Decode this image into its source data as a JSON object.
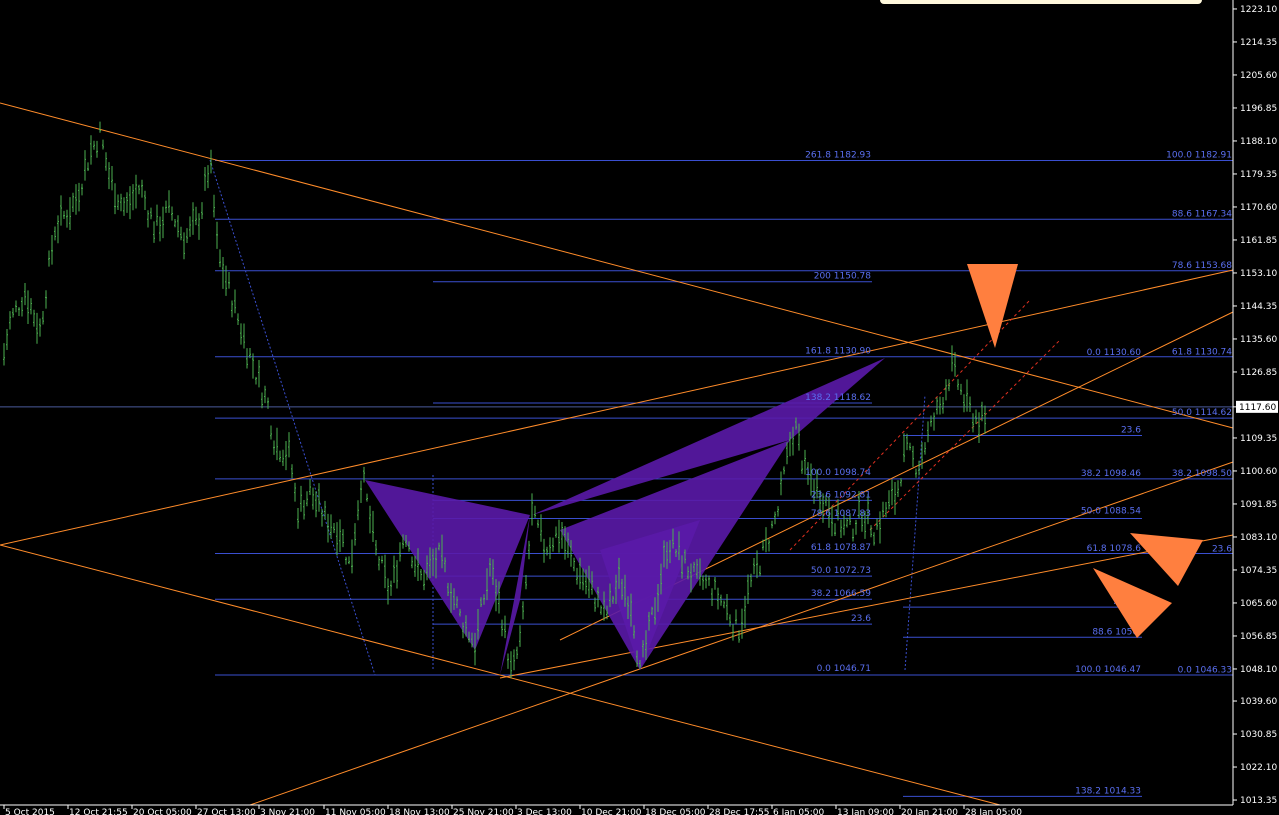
{
  "chart_data": {
    "type": "candlestick",
    "y_axis": {
      "range": [
        1010.0,
        1226.0
      ],
      "ticks": [
        "1223.10",
        "1214.35",
        "1205.60",
        "1196.85",
        "1188.10",
        "1179.35",
        "1170.60",
        "1161.85",
        "1153.10",
        "1144.35",
        "1135.60",
        "1126.85",
        "1117.60",
        "1109.35",
        "1100.60",
        "1091.85",
        "1083.10",
        "1074.35",
        "1065.60",
        "1056.85",
        "1048.10",
        "1039.60",
        "1030.85",
        "1022.10",
        "1013.35"
      ],
      "current_price": "1117.60"
    },
    "x_axis": {
      "ticks": [
        "5 Oct 2015",
        "12 Oct 21:55",
        "20 Oct 05:00",
        "27 Oct 13:00",
        "3 Nov 21:00",
        "11 Nov 05:00",
        "18 Nov 13:00",
        "25 Nov 21:00",
        "3 Dec 13:00",
        "10 Dec 21:00",
        "18 Dec 05:00",
        "28 Dec 17:55",
        "6 Jan 05:00",
        "13 Jan 09:00",
        "20 Jan 21:00",
        "28 Jan 05:00"
      ]
    },
    "price_path": [
      [
        0,
        1126
      ],
      [
        10,
        1140
      ],
      [
        25,
        1148
      ],
      [
        40,
        1138
      ],
      [
        55,
        1165
      ],
      [
        75,
        1172
      ],
      [
        90,
        1185
      ],
      [
        100,
        1190
      ],
      [
        110,
        1178
      ],
      [
        125,
        1170
      ],
      [
        140,
        1176
      ],
      [
        155,
        1165
      ],
      [
        170,
        1170
      ],
      [
        185,
        1162
      ],
      [
        200,
        1168
      ],
      [
        210,
        1183
      ],
      [
        218,
        1158
      ],
      [
        230,
        1148
      ],
      [
        245,
        1135
      ],
      [
        258,
        1125
      ],
      [
        268,
        1118
      ],
      [
        275,
        1108
      ],
      [
        290,
        1105
      ],
      [
        297,
        1090
      ],
      [
        310,
        1095
      ],
      [
        325,
        1088
      ],
      [
        340,
        1085
      ],
      [
        350,
        1075
      ],
      [
        362,
        1100
      ],
      [
        375,
        1080
      ],
      [
        390,
        1068
      ],
      [
        405,
        1085
      ],
      [
        420,
        1072
      ],
      [
        440,
        1078
      ],
      [
        460,
        1062
      ],
      [
        475,
        1055
      ],
      [
        490,
        1075
      ],
      [
        500,
        1065
      ],
      [
        512,
        1046
      ],
      [
        522,
        1058
      ],
      [
        532,
        1089
      ],
      [
        545,
        1080
      ],
      [
        560,
        1085
      ],
      [
        575,
        1075
      ],
      [
        590,
        1070
      ],
      [
        605,
        1062
      ],
      [
        620,
        1072
      ],
      [
        632,
        1065
      ],
      [
        640,
        1047
      ],
      [
        655,
        1065
      ],
      [
        668,
        1082
      ],
      [
        680,
        1078
      ],
      [
        695,
        1072
      ],
      [
        710,
        1070
      ],
      [
        725,
        1065
      ],
      [
        738,
        1058
      ],
      [
        750,
        1070
      ],
      [
        765,
        1080
      ],
      [
        778,
        1090
      ],
      [
        790,
        1108
      ],
      [
        795,
        1113
      ],
      [
        805,
        1100
      ],
      [
        820,
        1095
      ],
      [
        835,
        1088
      ],
      [
        850,
        1085
      ],
      [
        862,
        1090
      ],
      [
        875,
        1085
      ],
      [
        885,
        1090
      ],
      [
        897,
        1095
      ],
      [
        905,
        1106
      ],
      [
        918,
        1102
      ],
      [
        928,
        1110
      ],
      [
        940,
        1118
      ],
      [
        952,
        1128
      ],
      [
        958,
        1124
      ],
      [
        966,
        1118
      ],
      [
        975,
        1115
      ],
      [
        985,
        1113
      ]
    ],
    "fib_labels": {
      "left": [
        {
          "text": "261.8  1182.93",
          "price": 1182.93
        },
        {
          "text": "200  1150.78",
          "price": 1150.78
        },
        {
          "text": "161.8  1130.90",
          "price": 1130.9
        },
        {
          "text": "138.2  1118.62",
          "price": 1118.62
        },
        {
          "text": "100.0  1098.74",
          "price": 1098.74
        },
        {
          "text": "23.6  1092.81",
          "price": 1092.81
        },
        {
          "text": "78.6  1087.83",
          "price": 1087.83
        },
        {
          "text": "61.8  1078.87",
          "price": 1078.87
        },
        {
          "text": "50.0  1072.73",
          "price": 1072.73
        },
        {
          "text": "38.2  1066.59",
          "price": 1066.59
        },
        {
          "text": "23.6",
          "price": 1060.0
        },
        {
          "text": "0.0  1046.71",
          "price": 1046.71
        }
      ],
      "middle": [
        {
          "text": "0.0  1130.60",
          "price": 1130.6
        },
        {
          "text": "23.6",
          "price": 1110.0
        },
        {
          "text": "38.2  1098.46",
          "price": 1098.46
        },
        {
          "text": "50.0  1088.54",
          "price": 1088.54
        },
        {
          "text": "61.8  1078.6",
          "price": 1078.6
        },
        {
          "text": "78.6  1",
          "price": 1064.5
        },
        {
          "text": "88.6  1056.",
          "price": 1056.5
        },
        {
          "text": "100.0  1046.47",
          "price": 1046.47
        },
        {
          "text": "138.2  1014.33",
          "price": 1014.33
        }
      ],
      "right": [
        {
          "text": "100.0  1182.91",
          "price": 1182.91
        },
        {
          "text": "88.6  1167.34",
          "price": 1167.34
        },
        {
          "text": "78.6  1153.68",
          "price": 1153.68
        },
        {
          "text": "61.8  1130.74",
          "price": 1130.74
        },
        {
          "text": "50.0  1114.62",
          "price": 1114.62
        },
        {
          "text": "38.2  1098.50",
          "price": 1098.5
        },
        {
          "text": "23.6",
          "price": 1078.5
        },
        {
          "text": "0.0  1046.33",
          "price": 1046.33
        }
      ]
    },
    "colors": {
      "background": "#000000",
      "candles": "#4caf50",
      "fib_lines": "#3a4fd0",
      "fib_text": "#5a6ff0",
      "trendlines": "#ff8c2a",
      "pattern_fill": "#5a1aa8",
      "arrows": "#ff7f3f"
    }
  }
}
